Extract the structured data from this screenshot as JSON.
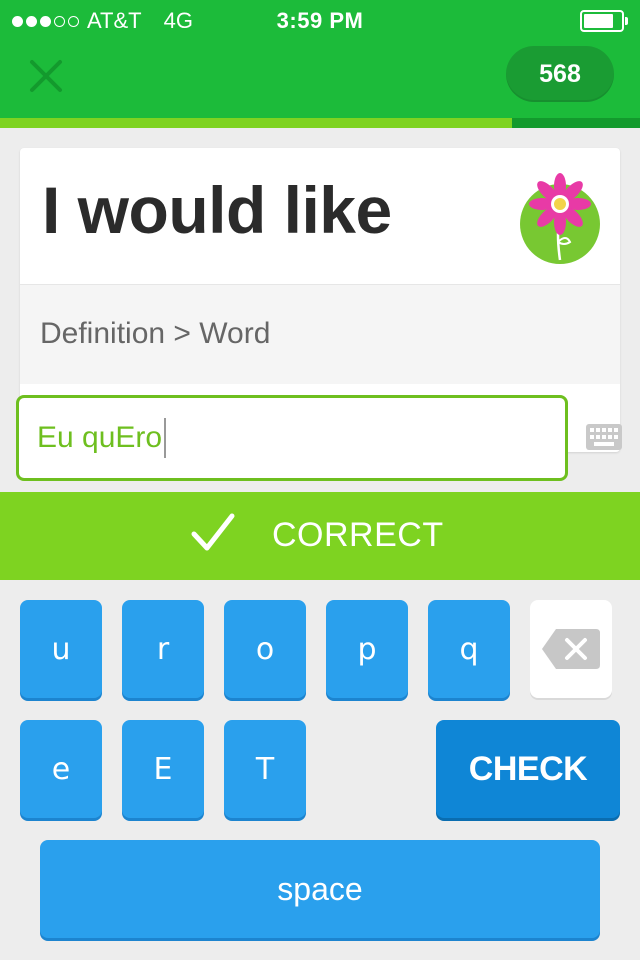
{
  "status_bar": {
    "carrier": "AT&T",
    "network": "4G",
    "time": "3:59 PM",
    "signal_bars_filled": 3,
    "signal_bars_total": 5,
    "battery_level": 0.8
  },
  "header": {
    "close_icon": "close-icon",
    "xp_count": "568",
    "lesson_progress": 0.8,
    "colors": {
      "header": "#1cbb3a",
      "pill": "#1a9c33",
      "progress_fill": "#7ed321",
      "progress_track": "#139a2d"
    }
  },
  "card": {
    "prompt": "I would like",
    "avatar_icon": "flower-icon",
    "exercise_type": "Definition > Word"
  },
  "answer": {
    "value": "Eu quEro",
    "keyboard_icon": "keyboard-icon"
  },
  "result": {
    "icon": "checkmark-icon",
    "label": "CORRECT",
    "color": "#7ed321"
  },
  "keyboard": {
    "row1": [
      "u",
      "r",
      "o",
      "p",
      "q"
    ],
    "row2": [
      "e",
      "E",
      "T"
    ],
    "backspace_icon": "backspace-icon",
    "check_label": "CHECK",
    "space_label": "space",
    "key_color": "#2aa0ed",
    "check_color": "#0f86d6"
  }
}
